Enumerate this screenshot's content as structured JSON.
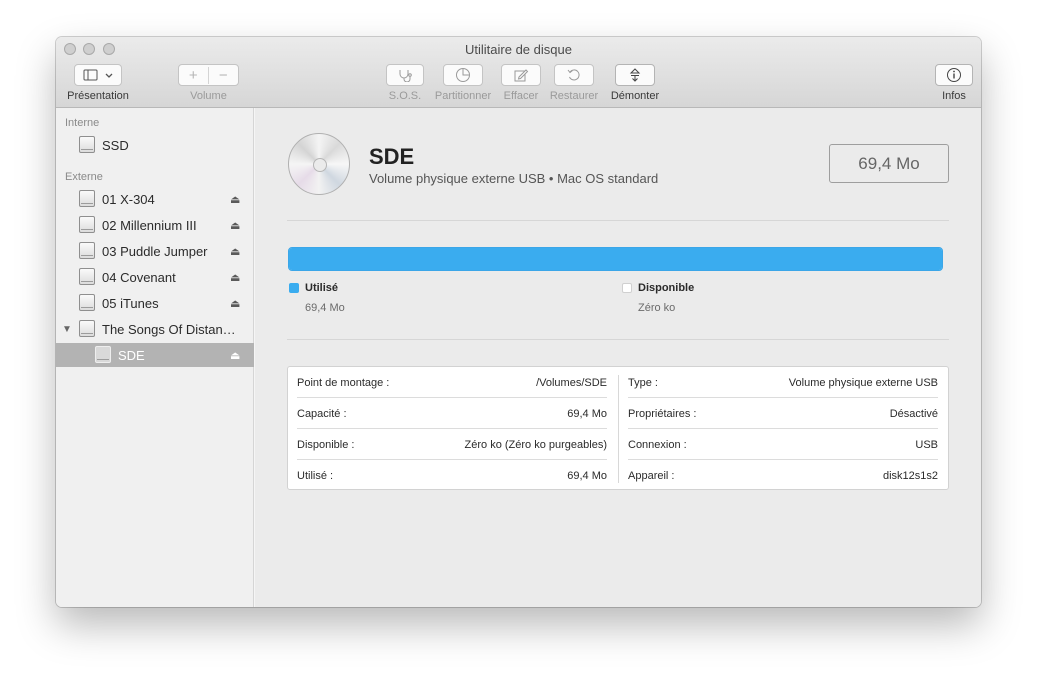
{
  "window": {
    "title": "Utilitaire de disque"
  },
  "toolbar": {
    "view_label": "Présentation",
    "volume_label": "Volume",
    "actions": [
      {
        "label": "S.O.S.",
        "icon": "stethoscope-icon",
        "enabled": false
      },
      {
        "label": "Partitionner",
        "icon": "pie-icon",
        "enabled": false
      },
      {
        "label": "Effacer",
        "icon": "erase-icon",
        "enabled": false
      },
      {
        "label": "Restaurer",
        "icon": "restore-icon",
        "enabled": false
      },
      {
        "label": "Démonter",
        "icon": "unmount-icon",
        "enabled": true
      }
    ],
    "info_label": "Infos"
  },
  "sidebar": {
    "internal_label": "Interne",
    "external_label": "Externe",
    "internal": [
      {
        "label": "SSD"
      }
    ],
    "external": [
      {
        "label": "01 X-304",
        "eject": true
      },
      {
        "label": "02 Millennium III",
        "eject": true
      },
      {
        "label": "03 Puddle Jumper",
        "eject": true
      },
      {
        "label": "04 Covenant",
        "eject": true
      },
      {
        "label": "05 iTunes",
        "eject": true
      },
      {
        "label": "The Songs Of Distan…",
        "eject": false,
        "expanded": true
      },
      {
        "label": "SDE",
        "eject": true,
        "selected": true
      }
    ]
  },
  "volume": {
    "name": "SDE",
    "subtitle": "Volume physique externe USB • Mac OS standard",
    "size": "69,4 Mo"
  },
  "usage": {
    "used_fraction": 1.0,
    "used_label": "Utilisé",
    "used_value": "69,4 Mo",
    "used_color": "#3aacef",
    "free_label": "Disponible",
    "free_value": "Zéro ko",
    "free_color": "#ffffff"
  },
  "info": {
    "left": [
      {
        "key": "Point de montage :",
        "value": "/Volumes/SDE"
      },
      {
        "key": "Capacité :",
        "value": "69,4 Mo"
      },
      {
        "key": "Disponible :",
        "value": "Zéro ko (Zéro ko purgeables)"
      },
      {
        "key": "Utilisé :",
        "value": "69,4 Mo"
      }
    ],
    "right": [
      {
        "key": "Type :",
        "value": "Volume physique externe USB"
      },
      {
        "key": "Propriétaires :",
        "value": "Désactivé"
      },
      {
        "key": "Connexion :",
        "value": "USB"
      },
      {
        "key": "Appareil :",
        "value": "disk12s1s2"
      }
    ]
  }
}
